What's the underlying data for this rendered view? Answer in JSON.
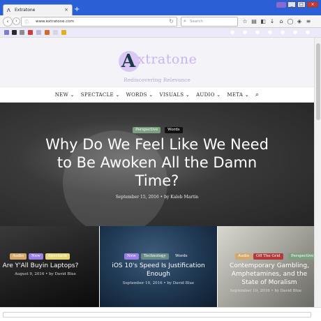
{
  "browser": {
    "tab_title": "Extratone",
    "url": "www.extratone.com",
    "search_placeholder": "Search",
    "new_tab_icon": "plus-icon",
    "tab_close_icon": "close-icon"
  },
  "site": {
    "logo_letter": "A",
    "logo_text": "xtratone",
    "tagline": "Rediscovering Relevance",
    "accent_color": "#cbb4f3",
    "menu": [
      "NEW",
      "SPECTACLE",
      "WORDS",
      "VISUALS",
      "AUDIO",
      "META"
    ]
  },
  "featured": {
    "badges": [
      "Perspective",
      "Words"
    ],
    "title": "Why Do We Feel Like We Need to Be Awoken All the Damn Time?",
    "meta": "September 15, 2016 • by Kaleb Martin"
  },
  "cards": [
    {
      "badges": [
        "Audio",
        "New",
        "Spectacle"
      ],
      "title": "Are Y'All Buyin Laptops?",
      "meta": "August 9, 2016 • by David Blue"
    },
    {
      "badges": [
        "New",
        "Technology",
        "Words"
      ],
      "title": "iOS 10's Speed Is Justification Enough",
      "meta": "September 10, 2016 • by David Blue"
    },
    {
      "badges": [
        "Audio",
        "Off The Grid",
        "Perspective"
      ],
      "title": "Contemporary Gambling, Amphetamines, and the State of Moralism",
      "meta": "September 10, 2016 • by David Blue"
    }
  ]
}
